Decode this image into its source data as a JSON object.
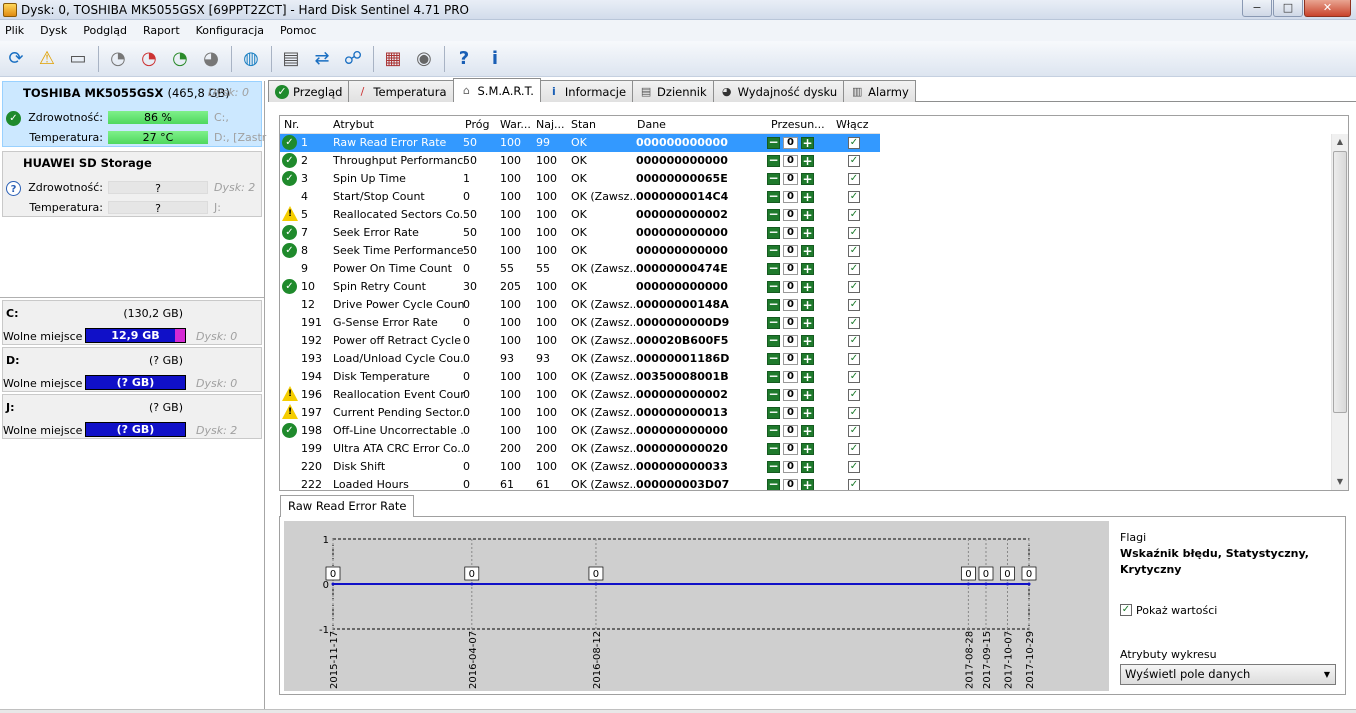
{
  "window": {
    "title": "Dysk: 0, TOSHIBA MK5055GSX [69PPT2ZCT]  -  Hard Disk Sentinel 4.71 PRO",
    "min": "−",
    "max": "□",
    "close": "✕"
  },
  "menu": [
    "Plik",
    "Dysk",
    "Podgląd",
    "Raport",
    "Konfiguracja",
    "Pomoc"
  ],
  "toolbar": {
    "icons": [
      "refresh-icon",
      "alert-bell-icon",
      "disk-drive-icon",
      "satellite-dish-icon",
      "satellite-dish-warning-icon",
      "satellite-dish-ok-icon",
      "satellite-dish-settings-icon",
      "globe-icon",
      "document-icon",
      "sync-icon",
      "network-icon",
      "report-icon",
      "speaker-icon",
      "help-icon",
      "info-icon"
    ]
  },
  "disks": [
    {
      "name": "TOSHIBA MK5055GSX",
      "size": "(465,8 GB)",
      "num": "Dysk: 0",
      "health_label": "Zdrowotność:",
      "health": "86 %",
      "health_pct": 0.86,
      "temp_label": "Temperatura:",
      "temp": "27 °C",
      "drive1": "C:,",
      "drive2": "D:, [Zastr"
    },
    {
      "name": "HUAWEI  SD Storage",
      "size": "",
      "num": "Dysk: 2",
      "health_label": "Zdrowotność:",
      "health": "?",
      "temp_label": "Temperatura:",
      "temp": "?",
      "drive1": "J:"
    }
  ],
  "partitions": [
    {
      "letter": "C:",
      "size": "(130,2 GB)",
      "free_label": "Wolne miejsce",
      "free": "12,9 GB",
      "disk": "Dysk: 0"
    },
    {
      "letter": "D:",
      "size": "(? GB)",
      "free_label": "Wolne miejsce",
      "free": "(? GB)",
      "disk": "Dysk: 0"
    },
    {
      "letter": "J:",
      "size": "(? GB)",
      "free_label": "Wolne miejsce",
      "free": "(? GB)",
      "disk": "Dysk: 2"
    }
  ],
  "tabs": [
    "Przegląd",
    "Temperatura",
    "S.M.A.R.T.",
    "Informacje",
    "Dziennik",
    "Wydajność dysku",
    "Alarmy"
  ],
  "smart": {
    "headers": [
      "Nr.",
      "Atrybut",
      "Próg",
      "War...",
      "Naj...",
      "Stan",
      "Dane",
      "Przesun...",
      "Włącz"
    ],
    "rows": [
      {
        "icon": "ok",
        "nr": "1",
        "attr": "Raw Read Error Rate",
        "prog": "50",
        "war": "100",
        "naj": "99",
        "stan": "OK",
        "dane": "000000000000"
      },
      {
        "icon": "ok",
        "nr": "2",
        "attr": "Throughput Performance",
        "prog": "50",
        "war": "100",
        "naj": "100",
        "stan": "OK",
        "dane": "000000000000"
      },
      {
        "icon": "ok",
        "nr": "3",
        "attr": "Spin Up Time",
        "prog": "1",
        "war": "100",
        "naj": "100",
        "stan": "OK",
        "dane": "00000000065E"
      },
      {
        "icon": "",
        "nr": "4",
        "attr": "Start/Stop Count",
        "prog": "0",
        "war": "100",
        "naj": "100",
        "stan": "OK (Zawsz...",
        "dane": "0000000014C4"
      },
      {
        "icon": "warn",
        "nr": "5",
        "attr": "Reallocated Sectors Co...",
        "prog": "50",
        "war": "100",
        "naj": "100",
        "stan": "OK",
        "dane": "000000000002"
      },
      {
        "icon": "ok",
        "nr": "7",
        "attr": "Seek Error Rate",
        "prog": "50",
        "war": "100",
        "naj": "100",
        "stan": "OK",
        "dane": "000000000000"
      },
      {
        "icon": "ok",
        "nr": "8",
        "attr": "Seek Time Performance",
        "prog": "50",
        "war": "100",
        "naj": "100",
        "stan": "OK",
        "dane": "000000000000"
      },
      {
        "icon": "",
        "nr": "9",
        "attr": "Power On Time Count",
        "prog": "0",
        "war": "55",
        "naj": "55",
        "stan": "OK (Zawsz...",
        "dane": "00000000474E"
      },
      {
        "icon": "ok",
        "nr": "10",
        "attr": "Spin Retry Count",
        "prog": "30",
        "war": "205",
        "naj": "100",
        "stan": "OK",
        "dane": "000000000000"
      },
      {
        "icon": "",
        "nr": "12",
        "attr": "Drive Power Cycle Count",
        "prog": "0",
        "war": "100",
        "naj": "100",
        "stan": "OK (Zawsz...",
        "dane": "00000000148A"
      },
      {
        "icon": "",
        "nr": "191",
        "attr": "G-Sense Error Rate",
        "prog": "0",
        "war": "100",
        "naj": "100",
        "stan": "OK (Zawsz...",
        "dane": "0000000000D9"
      },
      {
        "icon": "",
        "nr": "192",
        "attr": "Power off Retract Cycle ...",
        "prog": "0",
        "war": "100",
        "naj": "100",
        "stan": "OK (Zawsz...",
        "dane": "000020B600F5"
      },
      {
        "icon": "",
        "nr": "193",
        "attr": "Load/Unload Cycle Cou...",
        "prog": "0",
        "war": "93",
        "naj": "93",
        "stan": "OK (Zawsz...",
        "dane": "00000001186D"
      },
      {
        "icon": "",
        "nr": "194",
        "attr": "Disk Temperature",
        "prog": "0",
        "war": "100",
        "naj": "100",
        "stan": "OK (Zawsz...",
        "dane": "00350008001B"
      },
      {
        "icon": "warn",
        "nr": "196",
        "attr": "Reallocation Event Count",
        "prog": "0",
        "war": "100",
        "naj": "100",
        "stan": "OK (Zawsz...",
        "dane": "000000000002"
      },
      {
        "icon": "warn",
        "nr": "197",
        "attr": "Current Pending Sector...",
        "prog": "0",
        "war": "100",
        "naj": "100",
        "stan": "OK (Zawsz...",
        "dane": "000000000013"
      },
      {
        "icon": "ok",
        "nr": "198",
        "attr": "Off-Line Uncorrectable ...",
        "prog": "0",
        "war": "100",
        "naj": "100",
        "stan": "OK (Zawsz...",
        "dane": "000000000000"
      },
      {
        "icon": "",
        "nr": "199",
        "attr": "Ultra ATA CRC Error Co...",
        "prog": "0",
        "war": "200",
        "naj": "200",
        "stan": "OK (Zawsz...",
        "dane": "000000000020"
      },
      {
        "icon": "",
        "nr": "220",
        "attr": "Disk Shift",
        "prog": "0",
        "war": "100",
        "naj": "100",
        "stan": "OK (Zawsz...",
        "dane": "000000000033"
      },
      {
        "icon": "",
        "nr": "222",
        "attr": "Loaded Hours",
        "prog": "0",
        "war": "61",
        "naj": "61",
        "stan": "OK (Zawsz...",
        "dane": "000000003D07"
      }
    ],
    "offset": "0"
  },
  "chart": {
    "tab": "Raw Read Error Rate",
    "yticks": [
      "1",
      "0",
      "-1"
    ],
    "dates": [
      "2015-11-17",
      "2016-04-07",
      "2016-08-12",
      "2017-08-28",
      "2017-09-15",
      "2017-10-07",
      "2017-10-29"
    ],
    "point_label": "0",
    "flags_label": "Flagi",
    "flags_value": "Wskaźnik błędu, Statystyczny, Krytyczny",
    "show_values": "Pokaż wartości",
    "attrs_label": "Atrybuty wykresu",
    "attrs_value": "Wyświetl pole danych"
  },
  "chart_data": {
    "type": "line",
    "x": [
      "2015-11-17",
      "2016-04-07",
      "2016-08-12",
      "2017-08-28",
      "2017-09-15",
      "2017-10-07",
      "2017-10-29"
    ],
    "series": [
      {
        "name": "Raw Read Error Rate",
        "values": [
          0,
          0,
          0,
          0,
          0,
          0,
          0
        ]
      }
    ],
    "ylim": [
      -1,
      1
    ],
    "grid": true
  }
}
